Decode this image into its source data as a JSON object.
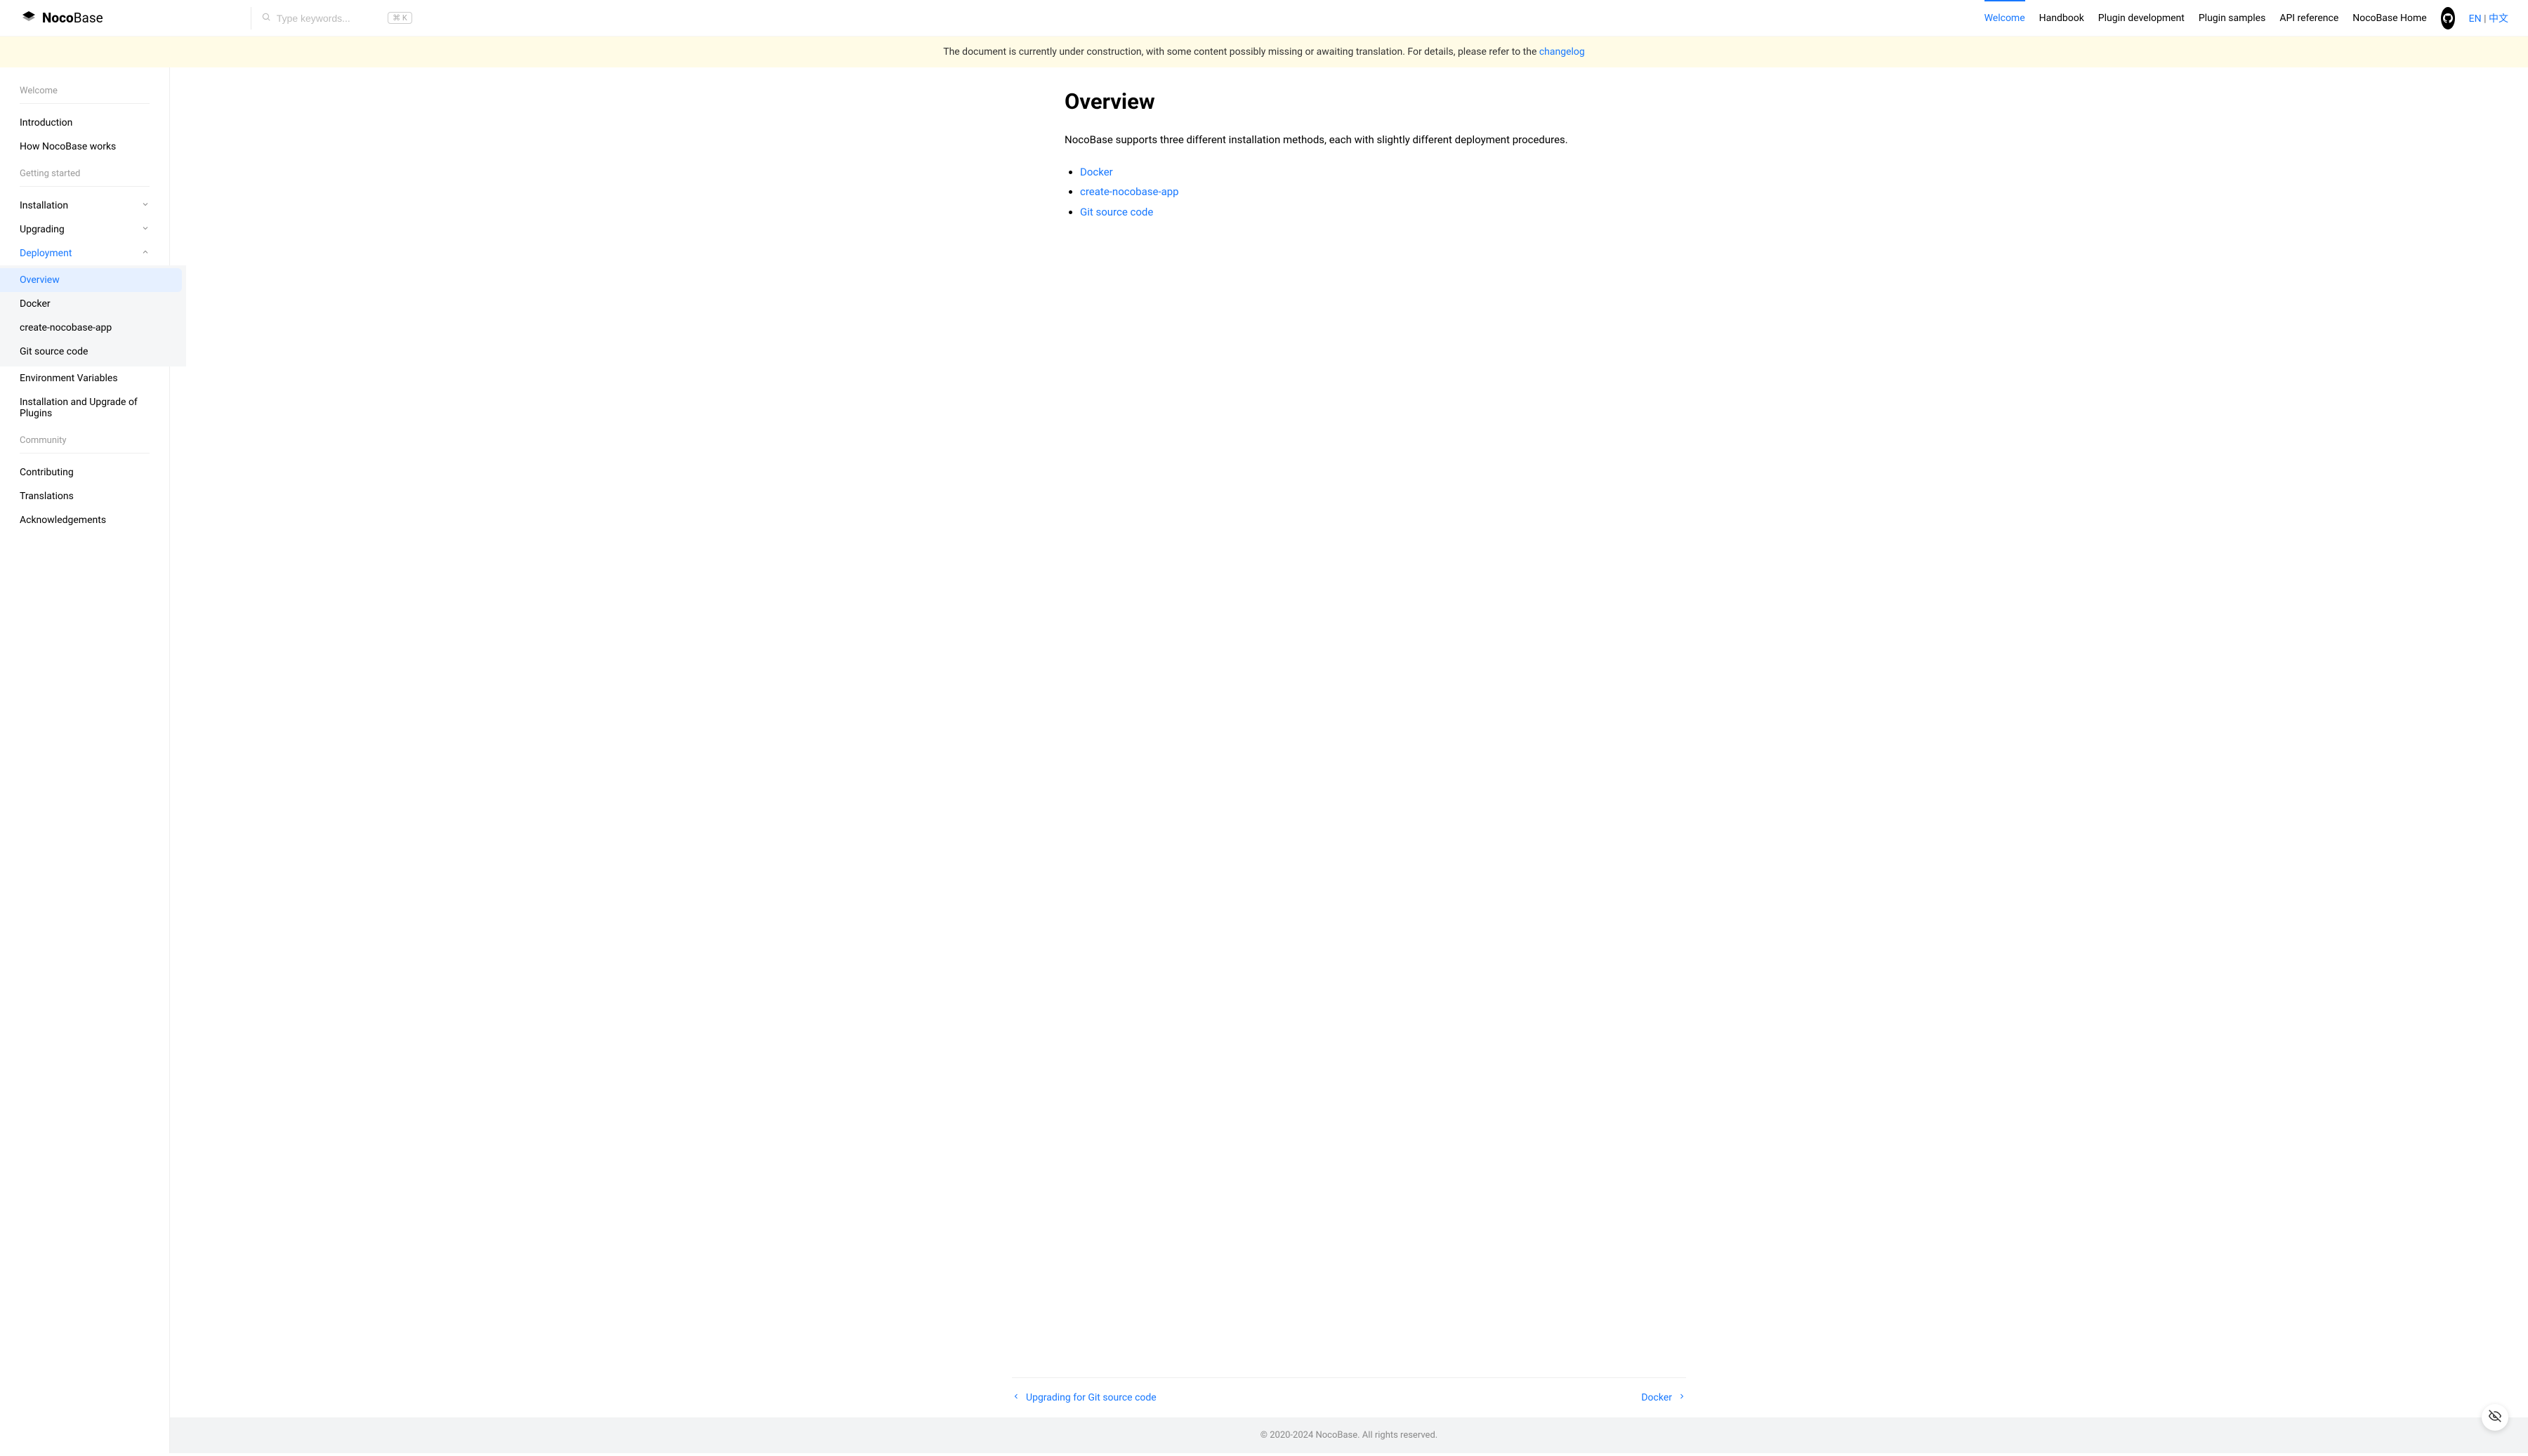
{
  "brand": {
    "bold": "Noco",
    "light": "Base"
  },
  "search": {
    "placeholder": "Type keywords...",
    "kbd": "⌘ K"
  },
  "nav": {
    "items": [
      {
        "label": "Welcome",
        "active": true
      },
      {
        "label": "Handbook"
      },
      {
        "label": "Plugin development"
      },
      {
        "label": "Plugin samples"
      },
      {
        "label": "API reference"
      },
      {
        "label": "NocoBase Home"
      }
    ],
    "lang_en": "EN",
    "lang_sep": " | ",
    "lang_zh": "中文"
  },
  "banner": {
    "text": "The document is currently under construction, with some content possibly missing or awaiting translation. For details, please refer to the ",
    "link": "changelog"
  },
  "sidebar": {
    "sections": [
      {
        "title": "Welcome",
        "items": [
          {
            "label": "Introduction"
          },
          {
            "label": "How NocoBase works"
          }
        ]
      },
      {
        "title": "Getting started",
        "items": [
          {
            "label": "Installation",
            "chevron": "down"
          },
          {
            "label": "Upgrading",
            "chevron": "down"
          },
          {
            "label": "Deployment",
            "chevron": "up",
            "active": true,
            "children": [
              {
                "label": "Overview",
                "active": true
              },
              {
                "label": "Docker"
              },
              {
                "label": "create-nocobase-app"
              },
              {
                "label": "Git source code"
              }
            ]
          },
          {
            "label": "Environment Variables"
          },
          {
            "label": "Installation and Upgrade of Plugins"
          }
        ]
      },
      {
        "title": "Community",
        "items": [
          {
            "label": "Contributing"
          },
          {
            "label": "Translations"
          },
          {
            "label": "Acknowledgements"
          }
        ]
      }
    ]
  },
  "page": {
    "title": "Overview",
    "intro": "NocoBase supports three different installation methods, each with slightly different deployment procedures.",
    "links": [
      {
        "label": "Docker"
      },
      {
        "label": "create-nocobase-app"
      },
      {
        "label": "Git source code"
      }
    ]
  },
  "pager": {
    "prev": "Upgrading for Git source code",
    "next": "Docker"
  },
  "footer": "© 2020-2024 NocoBase. All rights reserved."
}
